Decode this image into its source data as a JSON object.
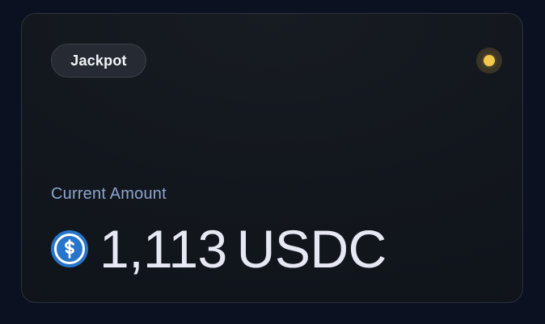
{
  "card": {
    "badge_label": "Jackpot",
    "status_color": "#F2C94C",
    "label": "Current Amount",
    "amount": {
      "value": "1,113",
      "unit": "USDC"
    },
    "currency_icon": "usdc-coin-icon"
  },
  "colors": {
    "background": "#0B1120",
    "card": "#12161D",
    "badge_bg": "#262B33",
    "label": "#8EA5CF",
    "amount": "#E6E8F3",
    "usdc_blue": "#2775CA"
  }
}
